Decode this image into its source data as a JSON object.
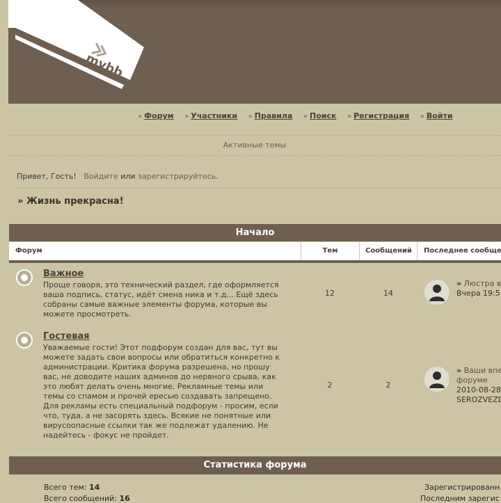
{
  "colors": {
    "brown": "#6e5f51",
    "background": "#cbc5a6",
    "logo_band": "#ffffff"
  },
  "logo_text": "mybb",
  "nav": {
    "items": [
      {
        "label": "Форум"
      },
      {
        "label": "Участники"
      },
      {
        "label": "Правила"
      },
      {
        "label": "Поиск"
      },
      {
        "label": "Регистрация"
      },
      {
        "label": "Войти"
      }
    ]
  },
  "active_topics": "Активные темы",
  "greeting": {
    "prefix": "Привет, Гость!",
    "login": "Войдите",
    "or": "или",
    "register": "зарегистрируйтесь",
    "suffix": "."
  },
  "slogan": "» Жизнь прекрасна!",
  "category": {
    "title": "Начало",
    "columns": {
      "forum": "Форум",
      "topics": "Тем",
      "posts": "Сообщений",
      "last": "Последнее сообщение"
    },
    "forums": [
      {
        "title": "Важное",
        "desc": "Проще говоря, это технический раздел, где оформляется ваша подпись, статус, идёт смена ника и т.д... Ещё здесь собраны самые важные элементы форума, которые вы можете просмотреть.",
        "topics": "12",
        "posts": "14",
        "last_title": "Люстра в",
        "last_date": "Вчера 19:5"
      },
      {
        "title": "Гостевая",
        "desc": "Уважаемые гости! Этот подфорум создан для вас, тут вы можете задать свои вопросы или обратиться конкретно к администрации. Критика форума разрешена, но прошу вас, не доводите наших админов до нервного срыва, как это любят делать очень многие. Рекламные темы или темы со спамом и прочей ересью создавать запрещено. Для рекламы есть специальный подфорум - просим, если что, туда, а не засорять здесь. Всякие не понятные или вирусоопасные ссылки так же подлежат удалению. Не надейтесь - фокус не пройдет.",
        "topics": "2",
        "posts": "2",
        "last_title": "Ваши впе",
        "last_title2": "форуме",
        "last_date": "2010-08-28",
        "last_author": "SEROZVEZD"
      }
    ]
  },
  "stats": {
    "title": "Статистика форума",
    "topics_label": "Всего тем:",
    "topics_value": "14",
    "posts_label": "Всего сообщений:",
    "posts_value": "16",
    "registered": "Зарегистрированн",
    "last_registered": "Последним зарегис"
  }
}
